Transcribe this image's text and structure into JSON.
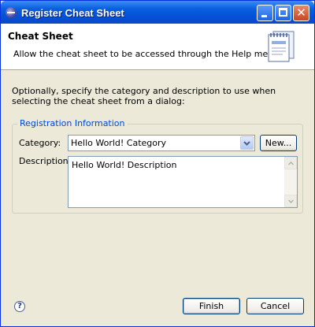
{
  "window": {
    "title": "Register Cheat Sheet"
  },
  "header": {
    "title": "Cheat Sheet",
    "description": "Allow the cheat sheet to be accessed through the Help menu",
    "image_icon": "cheat-sheet-wizard-icon"
  },
  "intro": "Optionally, specify the category and description to use when selecting the cheat sheet from a dialog:",
  "group": {
    "label": "Registration Information",
    "category_label": "Category:",
    "category_value": "Hello World! Category",
    "new_button": "New...",
    "description_label": "Description:",
    "description_value": "Hello World! Description"
  },
  "buttons": {
    "finish": "Finish",
    "cancel": "Cancel",
    "help_icon": "help-icon",
    "help_glyph": "?"
  },
  "colors": {
    "titlebar": "#0a5fe0",
    "group_label": "#0046d5",
    "dialog_bg": "#ece9d8"
  }
}
